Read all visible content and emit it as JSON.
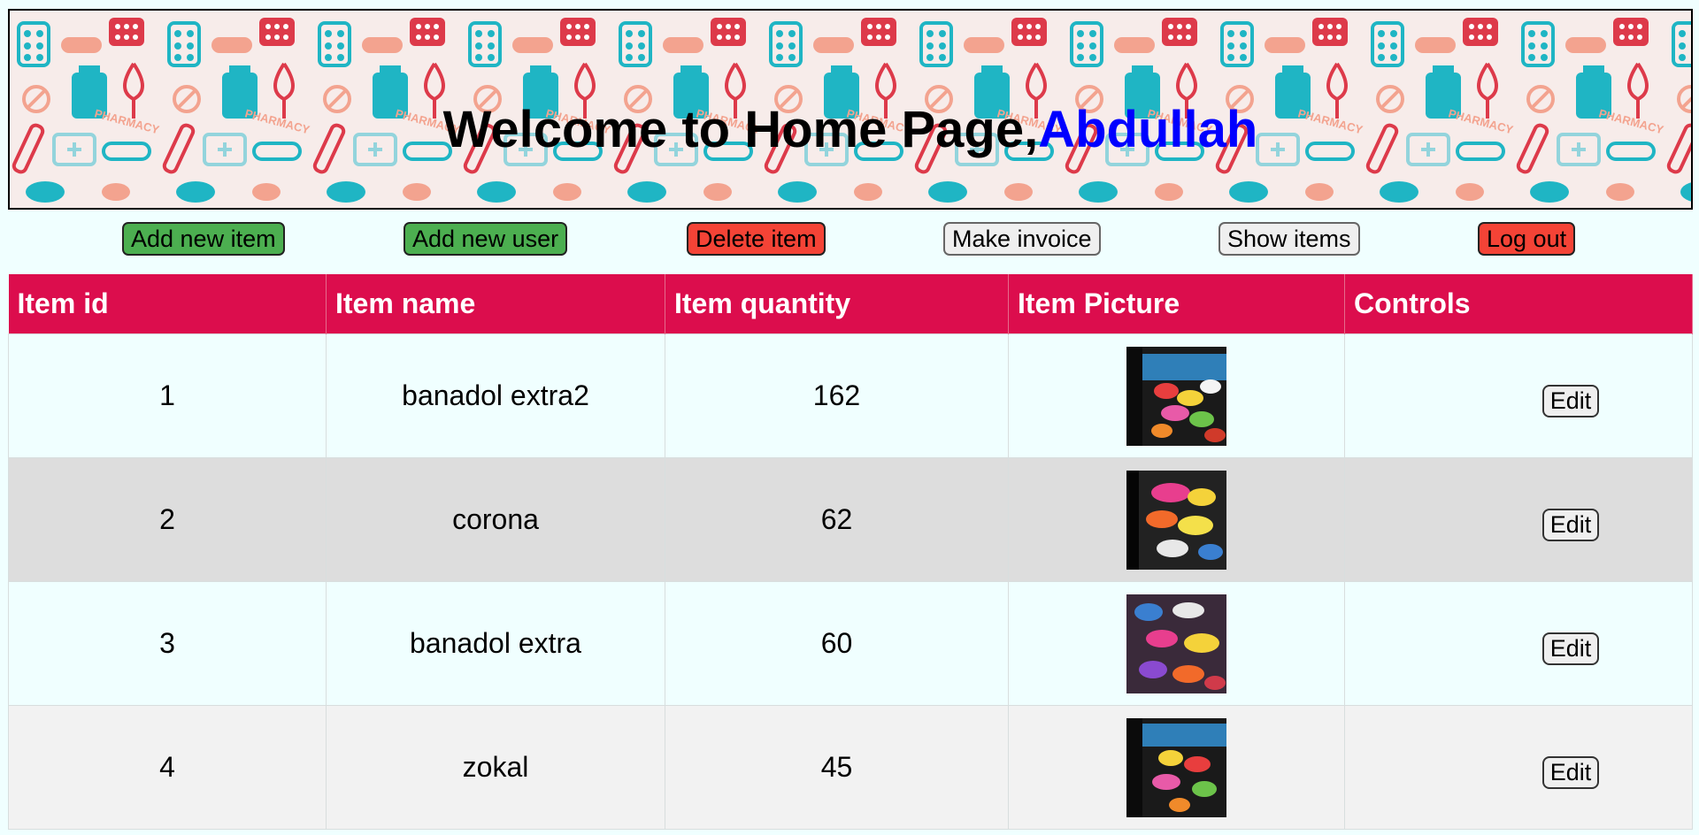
{
  "banner": {
    "greeting": "Welcome to Home Page,",
    "user_name": "Abdullah",
    "pattern_text": "PHARMACY"
  },
  "toolbar": {
    "add_item": "Add new item",
    "add_user": "Add new user",
    "delete_item": "Delete item",
    "make_invoice": "Make invoice",
    "show_items": "Show items",
    "log_out": "Log out"
  },
  "table": {
    "headers": [
      "Item id",
      "Item name",
      "Item quantity",
      "Item Picture",
      "Controls"
    ],
    "rows": [
      {
        "id": "1",
        "name": "banadol extra2",
        "quantity": "162",
        "edit_label": "Edit"
      },
      {
        "id": "2",
        "name": "corona",
        "quantity": "62",
        "edit_label": "Edit"
      },
      {
        "id": "3",
        "name": "banadol extra",
        "quantity": "60",
        "edit_label": "Edit"
      },
      {
        "id": "4",
        "name": "zokal",
        "quantity": "45",
        "edit_label": "Edit"
      }
    ]
  },
  "colors": {
    "page_bg": "#f0ffff",
    "header_bg": "#dc0d4d",
    "green_button": "#4caf50",
    "red_button": "#f44336",
    "user_name": "#0000ff"
  }
}
